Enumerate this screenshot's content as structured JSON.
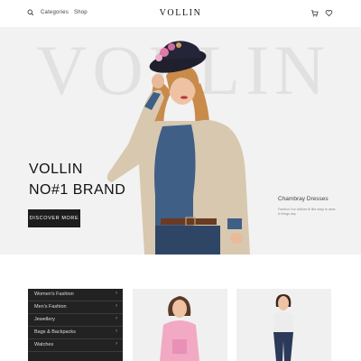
{
  "nav": {
    "search_icon": "search-icon",
    "categories_label": "Categories",
    "shop_label": "Shop",
    "brand": "VOLLIN",
    "cart_icon": "cart-icon",
    "wishlist_icon": "heart-icon"
  },
  "hero": {
    "background_word": "VOLLIN",
    "headline_line1": "VOLLIN",
    "headline_line2": "NO#1 BRAND",
    "cta_label": "DISCOVER MORE",
    "side_title": "Chambray Dresses",
    "side_desc": "Fashion Our clothes fit like easy to wear & things any"
  },
  "categories": [
    {
      "label": "Women's Fashion"
    },
    {
      "label": "Men's Fashion"
    },
    {
      "label": "Jewellery"
    },
    {
      "label": "Bags & Backpacks"
    },
    {
      "label": "Watches"
    }
  ],
  "colors": {
    "accent_dark": "#1d1d1d",
    "hero_bg": "#f2f2f2"
  }
}
